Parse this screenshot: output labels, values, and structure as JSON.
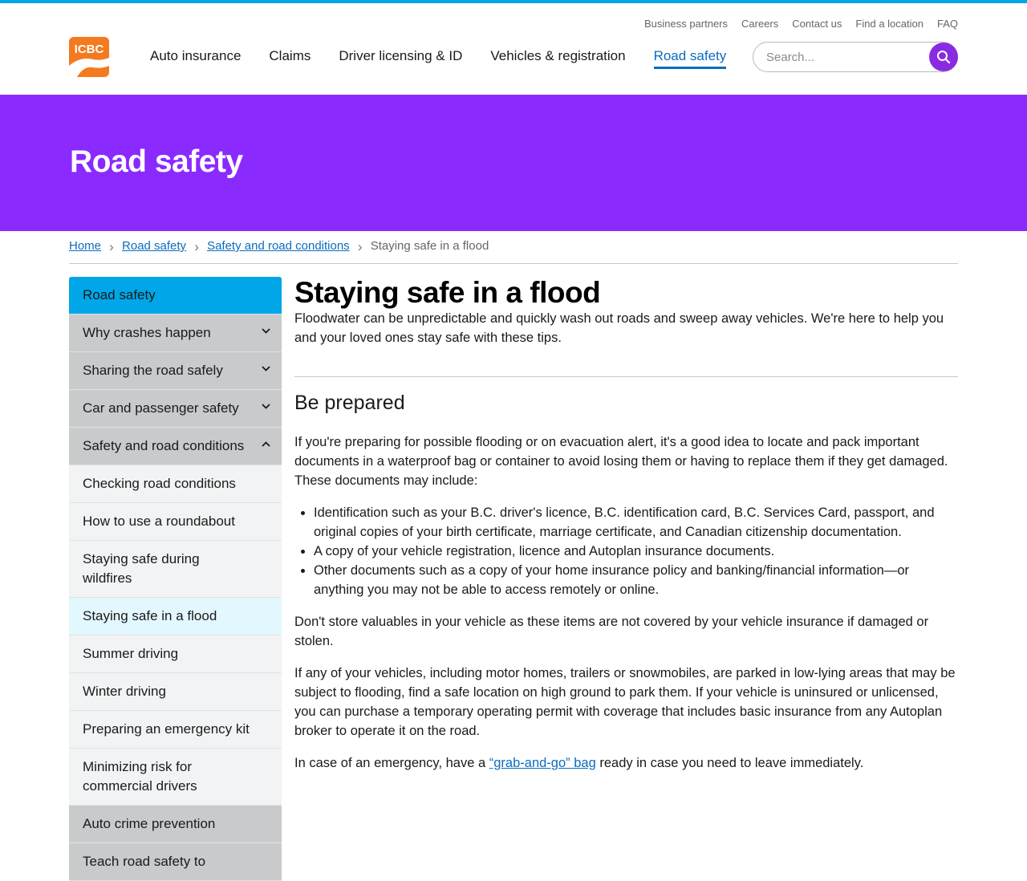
{
  "utility_nav": [
    "Business partners",
    "Careers",
    "Contact us",
    "Find a location",
    "FAQ"
  ],
  "logo_text": "ICBC",
  "main_nav": [
    "Auto insurance",
    "Claims",
    "Driver licensing & ID",
    "Vehicles & registration",
    "Road safety"
  ],
  "active_nav": "Road safety",
  "search": {
    "placeholder": "Search..."
  },
  "banner": {
    "title": "Road safety"
  },
  "breadcrumb": {
    "links": [
      "Home",
      "Road safety",
      "Safety and road conditions"
    ],
    "current": "Staying safe in a flood"
  },
  "sidebar": {
    "top": "Road safety",
    "items": [
      "Why crashes happen",
      "Sharing the road safely",
      "Car and passenger safety",
      "Safety and road conditions",
      "Checking road conditions",
      "How to use a roundabout",
      "Staying safe during wildfires",
      "Staying safe in a flood",
      "Summer driving",
      "Winter driving",
      "Preparing an emergency kit",
      "Minimizing risk for commercial drivers",
      "Auto crime prevention",
      "Teach road safety to"
    ]
  },
  "content": {
    "title": "Staying safe in a flood",
    "lead": "Floodwater can be unpredictable and quickly wash out roads and sweep away vehicles. We're here to help you and your loved ones stay safe with these tips.",
    "section_heading": "Be prepared",
    "p1": "If you're preparing for possible flooding or on evacuation alert, it's a good idea to locate and pack important documents in a waterproof bag or container to avoid losing them or having to replace them if they get damaged. These documents may include:",
    "bullets": [
      "Identification such as your B.C. driver's licence, B.C. identification card, B.C. Services Card, passport, and original copies of your birth certificate, marriage certificate, and Canadian citizenship documentation.",
      "A copy of your vehicle registration, licence and Autoplan insurance documents.",
      "Other documents such as a copy of your home insurance policy and banking/financial information—or anything you may not be able to access remotely or online."
    ],
    "p2": "Don't store valuables in your vehicle as these items are not covered by your vehicle insurance if damaged or stolen.",
    "p3": "If any of your vehicles, including motor homes, trailers or snowmobiles, are parked in low-lying areas that may be subject to flooding, find a safe location on high ground to park them. If your vehicle is uninsured or unlicensed, you can purchase a temporary operating permit with coverage that includes basic insurance from any Autoplan broker to operate it on the road.",
    "p4_before": "In case of an emergency, have a ",
    "p4_link": "“grab-and-go” bag",
    "p4_after": " ready in case you need to leave immediately."
  },
  "colors": {
    "banner": "#8a2aff",
    "accent_blue": "#00a6e8",
    "link": "#0b6cbf",
    "logo_orange": "#f47a20",
    "search_button": "#8a2be2"
  }
}
